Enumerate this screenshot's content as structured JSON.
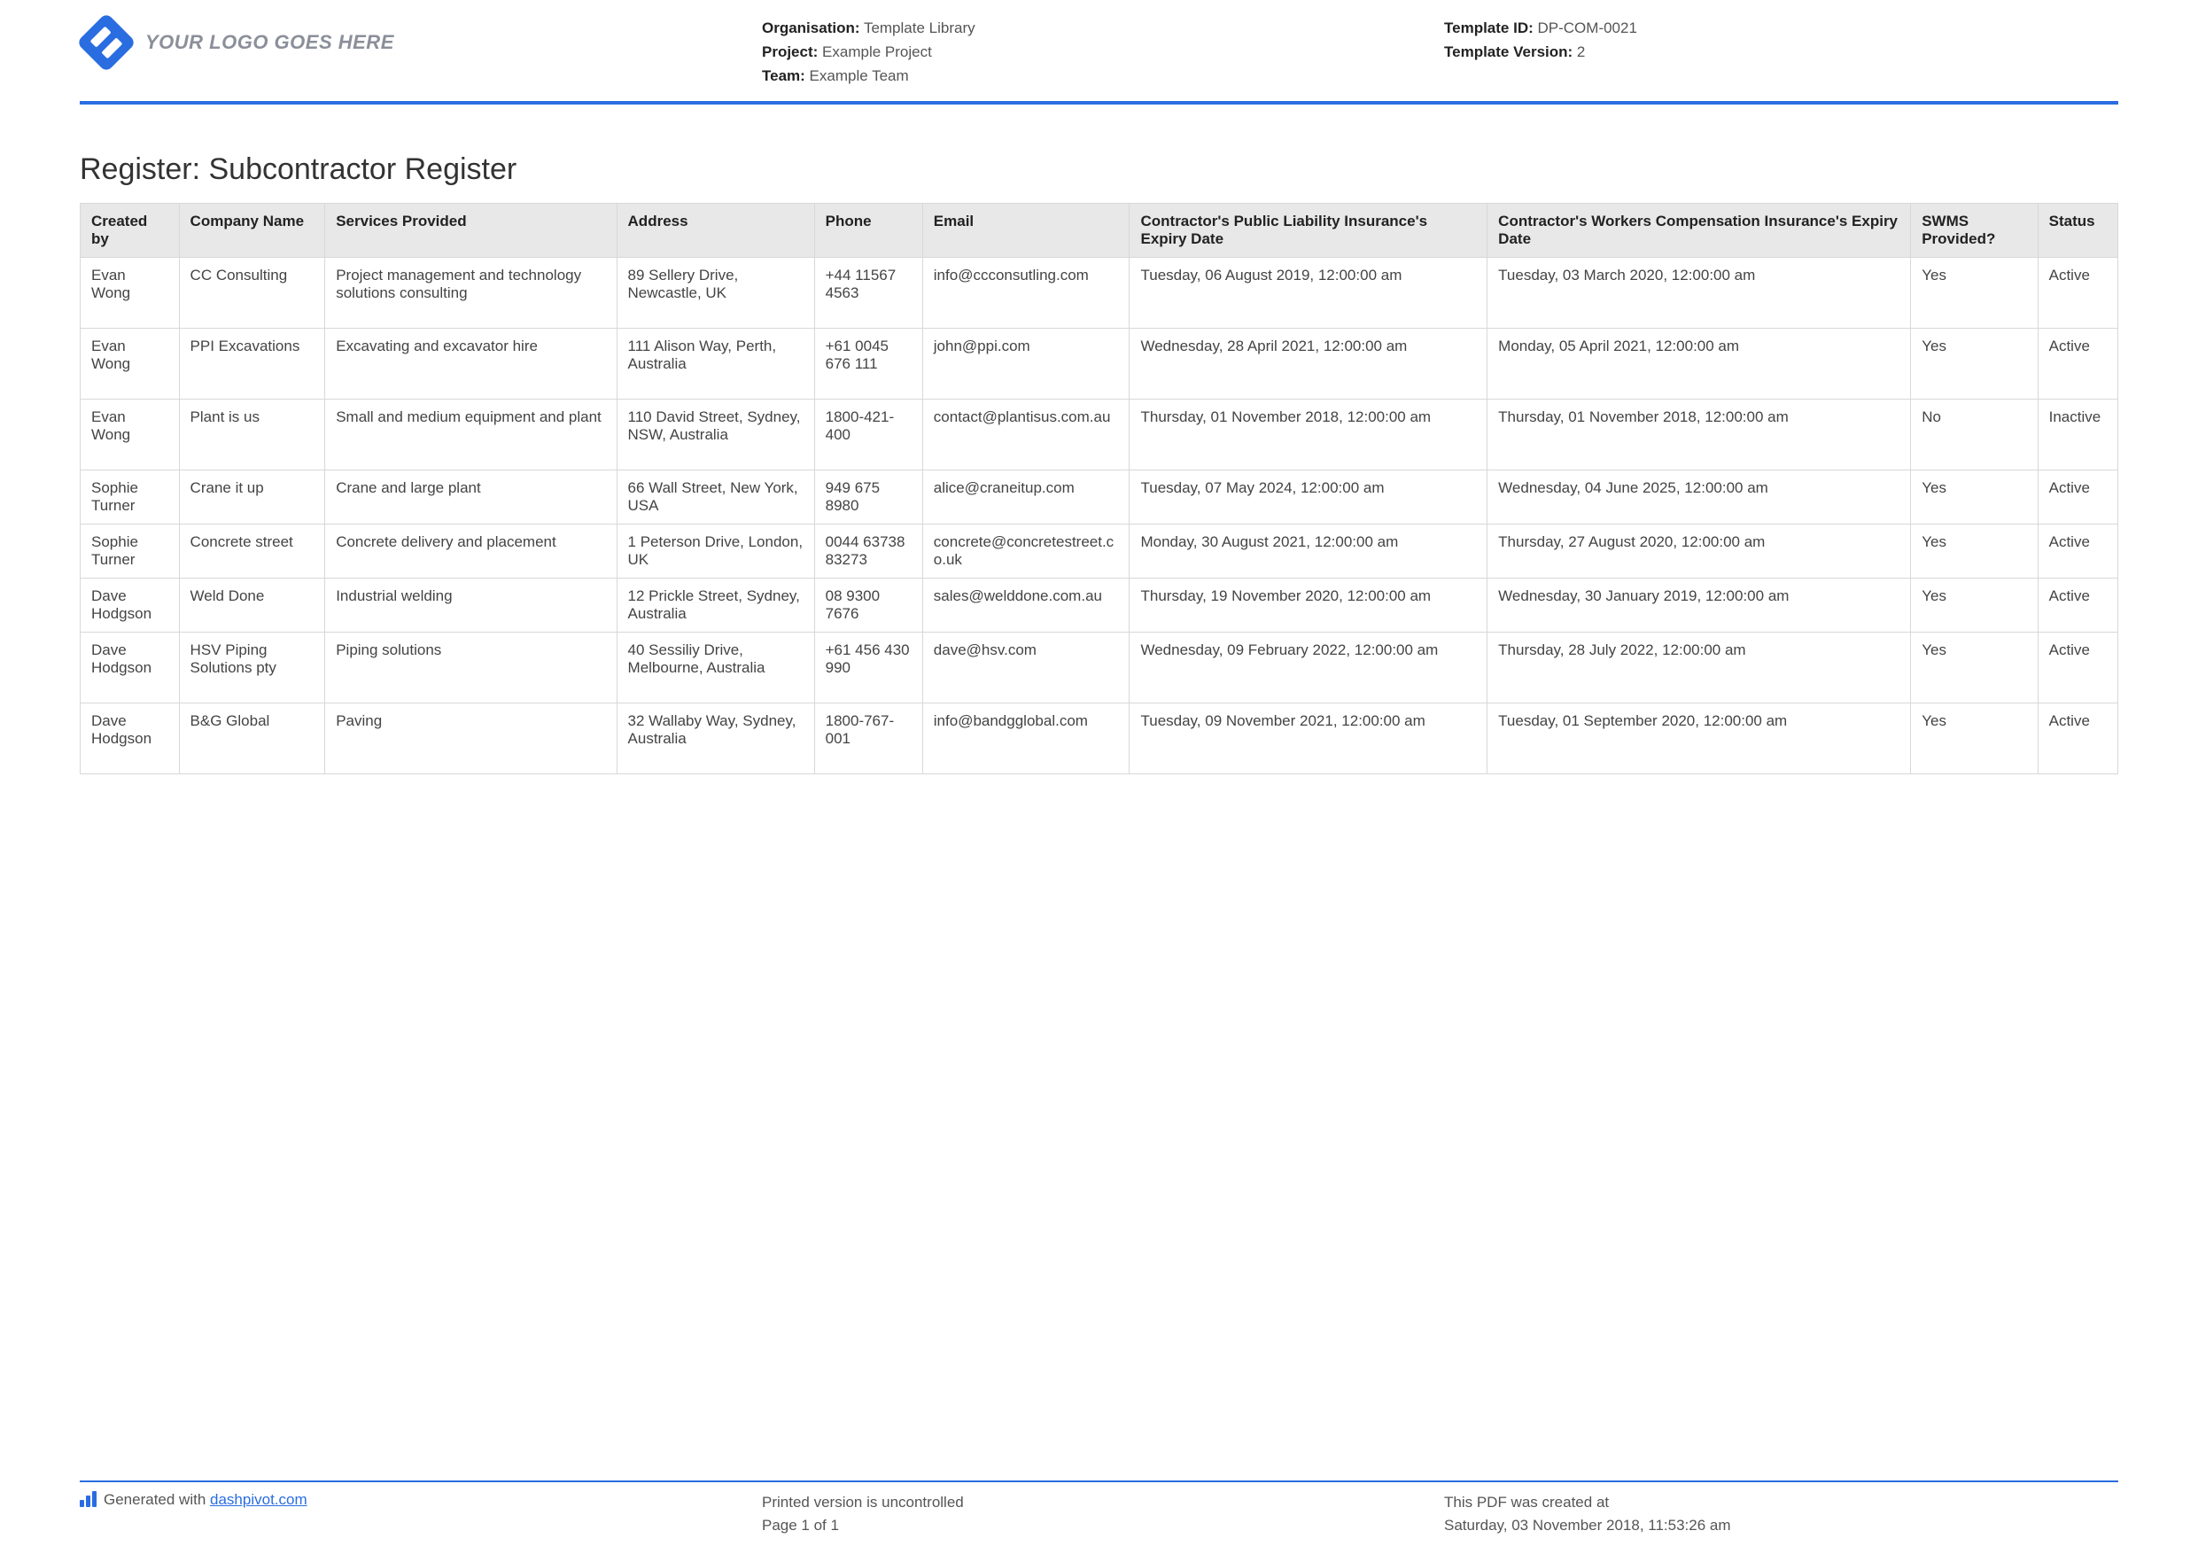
{
  "header": {
    "logo_text": "YOUR LOGO GOES HERE",
    "org_label": "Organisation:",
    "org_value": "Template Library",
    "project_label": "Project:",
    "project_value": "Example Project",
    "team_label": "Team:",
    "team_value": "Example Team",
    "template_id_label": "Template ID:",
    "template_id_value": "DP-COM-0021",
    "template_version_label": "Template Version:",
    "template_version_value": "2"
  },
  "title": "Register: Subcontractor Register",
  "columns": {
    "created_by": "Created by",
    "company": "Company Name",
    "services": "Services Provided",
    "address": "Address",
    "phone": "Phone",
    "email": "Email",
    "liability": "Contractor's Public Liability Insurance's Expiry Date",
    "workers": "Contractor's Workers Compensation Insurance's Expiry Date",
    "swms": "SWMS Provided?",
    "status": "Status"
  },
  "rows": [
    {
      "created_by": "Evan Wong",
      "company": "CC Consulting",
      "services": "Project management and technology solutions consulting",
      "address": "89 Sellery Drive, Newcastle, UK",
      "phone": "+44 11567 4563",
      "email": "info@ccconsutling.com",
      "liability": "Tuesday, 06 August 2019, 12:00:00 am",
      "workers": "Tuesday, 03 March 2020, 12:00:00 am",
      "swms": "Yes",
      "status": "Active"
    },
    {
      "created_by": "Evan Wong",
      "company": "PPI Excavations",
      "services": "Excavating and excavator hire",
      "address": "111 Alison Way, Perth, Australia",
      "phone": "+61 0045 676 111",
      "email": "john@ppi.com",
      "liability": "Wednesday, 28 April 2021, 12:00:00 am",
      "workers": "Monday, 05 April 2021, 12:00:00 am",
      "swms": "Yes",
      "status": "Active"
    },
    {
      "created_by": "Evan Wong",
      "company": "Plant is us",
      "services": "Small and medium equipment and plant",
      "address": "110 David Street, Sydney, NSW, Australia",
      "phone": "1800-421-400",
      "email": "contact@plantisus.com.au",
      "liability": "Thursday, 01 November 2018, 12:00:00 am",
      "workers": "Thursday, 01 November 2018, 12:00:00 am",
      "swms": "No",
      "status": "Inactive"
    },
    {
      "created_by": "Sophie Turner",
      "company": "Crane it up",
      "services": "Crane and large plant",
      "address": "66 Wall Street, New York, USA",
      "phone": "949 675 8980",
      "email": "alice@craneitup.com",
      "liability": "Tuesday, 07 May 2024, 12:00:00 am",
      "workers": "Wednesday, 04 June 2025, 12:00:00 am",
      "swms": "Yes",
      "status": "Active"
    },
    {
      "created_by": "Sophie Turner",
      "company": "Concrete street",
      "services": "Concrete delivery and placement",
      "address": "1 Peterson Drive, London, UK",
      "phone": "0044 63738 83273",
      "email": "concrete@concretestreet.co.uk",
      "liability": "Monday, 30 August 2021, 12:00:00 am",
      "workers": "Thursday, 27 August 2020, 12:00:00 am",
      "swms": "Yes",
      "status": "Active"
    },
    {
      "created_by": "Dave Hodgson",
      "company": "Weld Done",
      "services": "Industrial welding",
      "address": "12 Prickle Street, Sydney, Australia",
      "phone": "08 9300 7676",
      "email": "sales@welddone.com.au",
      "liability": "Thursday, 19 November 2020, 12:00:00 am",
      "workers": "Wednesday, 30 January 2019, 12:00:00 am",
      "swms": "Yes",
      "status": "Active"
    },
    {
      "created_by": "Dave Hodgson",
      "company": "HSV Piping Solutions pty",
      "services": "Piping solutions",
      "address": "40 Sessiliy Drive, Melbourne, Australia",
      "phone": "+61 456 430 990",
      "email": "dave@hsv.com",
      "liability": "Wednesday, 09 February 2022, 12:00:00 am",
      "workers": "Thursday, 28 July 2022, 12:00:00 am",
      "swms": "Yes",
      "status": "Active"
    },
    {
      "created_by": "Dave Hodgson",
      "company": "B&G Global",
      "services": "Paving",
      "address": "32 Wallaby Way, Sydney, Australia",
      "phone": "1800-767-001",
      "email": "info@bandgglobal.com",
      "liability": "Tuesday, 09 November 2021, 12:00:00 am",
      "workers": "Tuesday, 01 September 2020, 12:00:00 am",
      "swms": "Yes",
      "status": "Active"
    }
  ],
  "footer": {
    "generated_prefix": "Generated with ",
    "generated_link": "dashpivot.com",
    "uncontrolled": "Printed version is uncontrolled",
    "page": "Page 1 of 1",
    "created_label": "This PDF was created at",
    "created_value": "Saturday, 03 November 2018, 11:53:26 am"
  }
}
